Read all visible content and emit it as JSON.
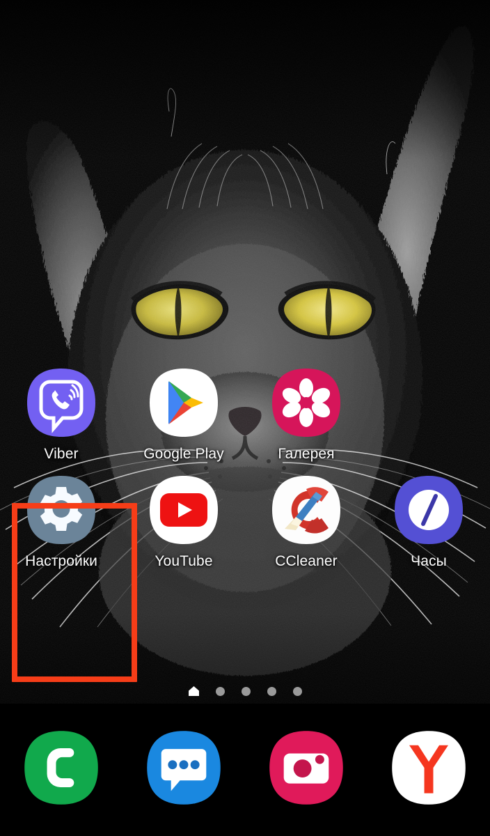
{
  "screen": {
    "type": "android-home-screen",
    "wallpaper_description": "black cat close-up photo, dark background, yellow eyes",
    "background_color": "#050505",
    "highlight": {
      "name": "settings-highlight-box",
      "color": "#f63d18",
      "target": "Настройки"
    }
  },
  "home_grid": {
    "row1": [
      {
        "label": "Viber",
        "icon": "viber-icon",
        "bg": "#7360f2"
      },
      {
        "label": "Google Play",
        "icon": "google-play-icon",
        "bg": "#ffffff"
      },
      {
        "label": "Галерея",
        "icon": "gallery-icon",
        "bg": "#d6155a"
      }
    ],
    "row2": [
      {
        "label": "Настройки",
        "icon": "settings-gear-icon",
        "bg": "#6b8499"
      },
      {
        "label": "YouTube",
        "icon": "youtube-icon",
        "bg": "#ffffff"
      },
      {
        "label": "CCleaner",
        "icon": "ccleaner-icon",
        "bg": "#ffffff"
      },
      {
        "label": "Часы",
        "icon": "clock-icon",
        "bg": "#5450d4"
      }
    ]
  },
  "page_indicator": {
    "total_pages": 5,
    "current_page": 1,
    "indicators": [
      "home-indicator",
      "page-dot",
      "page-dot",
      "page-dot",
      "page-dot"
    ]
  },
  "dock": [
    {
      "name": "phone",
      "icon": "phone-handset-icon",
      "bg": "#11a94c"
    },
    {
      "name": "messages",
      "icon": "messages-bubble-icon",
      "bg": "#1a88e0"
    },
    {
      "name": "camera",
      "icon": "camera-icon",
      "bg": "#e01a5a"
    },
    {
      "name": "yandex",
      "icon": "yandex-browser-icon",
      "bg": "#ffffff"
    }
  ]
}
